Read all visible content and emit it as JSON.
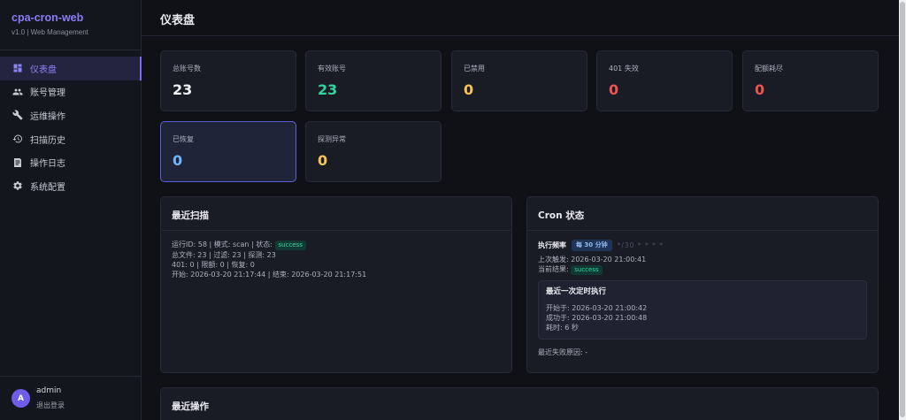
{
  "brand": {
    "title": "cpa-cron-web",
    "subtitle": "v1.0 | Web Management"
  },
  "nav": [
    {
      "label": "仪表盘",
      "icon": "dashboard-icon",
      "active": true
    },
    {
      "label": "账号管理",
      "icon": "users-icon"
    },
    {
      "label": "运维操作",
      "icon": "wrench-icon"
    },
    {
      "label": "扫描历史",
      "icon": "history-icon"
    },
    {
      "label": "操作日志",
      "icon": "log-icon"
    },
    {
      "label": "系统配置",
      "icon": "gear-icon"
    }
  ],
  "user": {
    "initial": "A",
    "name": "admin",
    "logout": "退出登录"
  },
  "header": {
    "title": "仪表盘"
  },
  "colors": {
    "accent": "#7c6df0",
    "green": "#2ed6a0",
    "yellow": "#f5c451",
    "red": "#ef5350",
    "blue": "#6cb6ff",
    "white": "#f0f1f5"
  },
  "stats": [
    {
      "label": "总账号数",
      "value": "23"
    },
    {
      "label": "有效账号",
      "value": "23"
    },
    {
      "label": "已禁用",
      "value": "0"
    },
    {
      "label": "401 失效",
      "value": "0"
    },
    {
      "label": "配额耗尽",
      "value": "0"
    },
    {
      "label": "已恢复",
      "value": "0"
    },
    {
      "label": "探测异常",
      "value": "0"
    }
  ],
  "recent_scan": {
    "title": "最近扫描",
    "line1_prefix": "运行ID: 58 | 模式: scan | 状态:",
    "status": "success",
    "line2": "总文件: 23 | 过滤: 23 | 探测: 23",
    "line3": "401: 0 | 限额: 0 | 恢复: 0",
    "line4": "开始: 2026-03-20 21:17:44 | 结束: 2026-03-20 21:17:51"
  },
  "cron": {
    "title": "Cron 状态",
    "freq_label": "执行频率",
    "freq_value": "每 30 分钟",
    "expression": "*/30 * * * *",
    "last_trigger": "上次触发: 2026-03-20 21:00:41",
    "current_result_label": "当前结果:",
    "current_result": "success",
    "last_run": {
      "title": "最近一次定时执行",
      "started": "开始于: 2026-03-20 21:00:42",
      "succeeded": "成功于: 2026-03-20 21:00:48",
      "duration": "耗时: 6 秒"
    },
    "last_failure": "最近失败原因: -"
  },
  "recent_ops": {
    "title": "最近操作"
  }
}
